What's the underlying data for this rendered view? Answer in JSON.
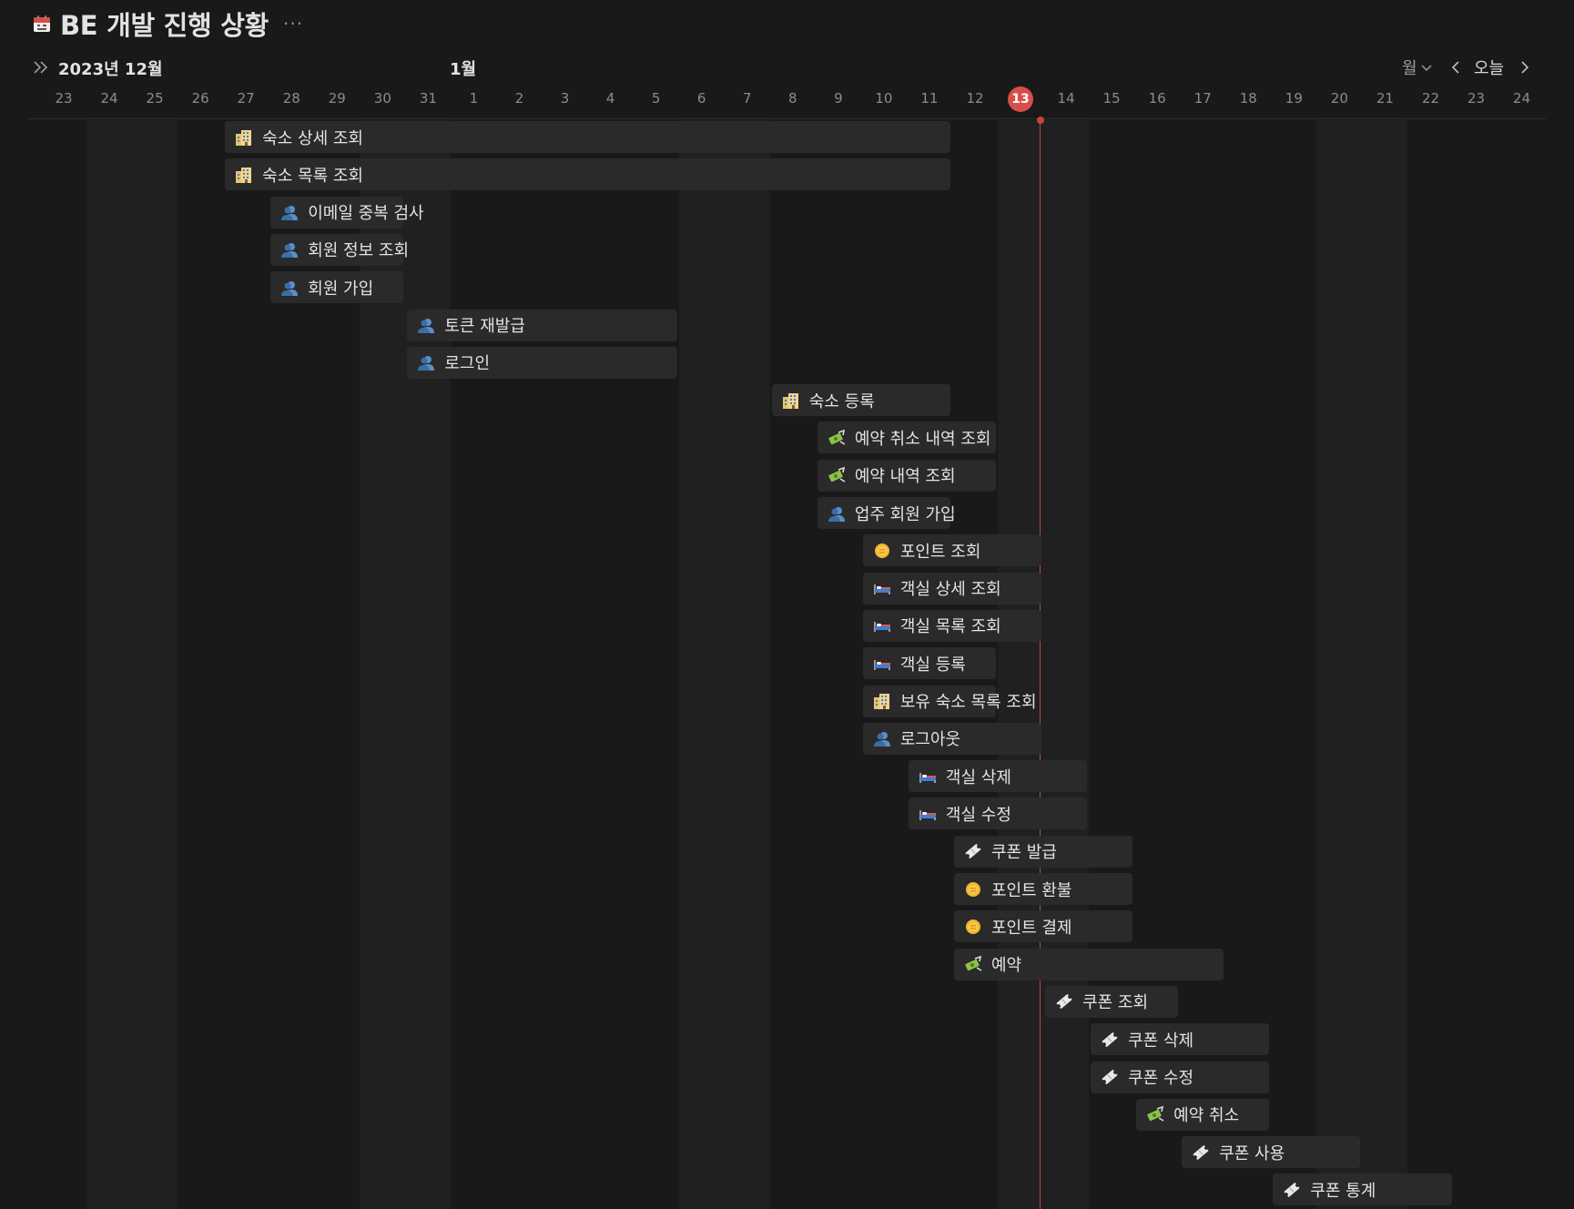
{
  "header": {
    "title": "BE 개발 진행 상황",
    "more": "···"
  },
  "nav": {
    "month": "2023년 12월",
    "next_month": "1월",
    "view": "월",
    "today": "오늘"
  },
  "timeline": {
    "days": [
      "23",
      "24",
      "25",
      "26",
      "27",
      "28",
      "29",
      "30",
      "31",
      "1",
      "2",
      "3",
      "4",
      "5",
      "6",
      "7",
      "8",
      "9",
      "10",
      "11",
      "12",
      "13",
      "14",
      "15",
      "16",
      "17",
      "18",
      "19",
      "20",
      "21",
      "22",
      "23",
      "24"
    ],
    "today_label": "13",
    "weekend_indices": [
      1,
      2,
      7,
      8,
      14,
      15,
      21,
      22,
      28,
      29
    ]
  },
  "tasks": [
    {
      "label": "숙소 상세 조회",
      "icon": "building",
      "start": 4,
      "end": 19
    },
    {
      "label": "숙소 목록 조회",
      "icon": "building",
      "start": 4,
      "end": 19
    },
    {
      "label": "이메일 중복 검사",
      "icon": "person",
      "start": 5,
      "end": 7
    },
    {
      "label": "회원 정보 조회",
      "icon": "person",
      "start": 5,
      "end": 7
    },
    {
      "label": "회원 가입",
      "icon": "person",
      "start": 5,
      "end": 7
    },
    {
      "label": "토큰 재발급",
      "icon": "person",
      "start": 8,
      "end": 13
    },
    {
      "label": "로그인",
      "icon": "person",
      "start": 8,
      "end": 13
    },
    {
      "label": "숙소 등록",
      "icon": "building",
      "start": 16,
      "end": 19
    },
    {
      "label": "예약 취소 내역 조회",
      "icon": "money",
      "start": 17,
      "end": 20
    },
    {
      "label": "예약 내역 조회",
      "icon": "money",
      "start": 17,
      "end": 20
    },
    {
      "label": "업주 회원 가입",
      "icon": "person",
      "start": 17,
      "end": 19
    },
    {
      "label": "포인트 조회",
      "icon": "coin",
      "start": 18,
      "end": 21
    },
    {
      "label": "객실 상세 조회",
      "icon": "bed",
      "start": 18,
      "end": 21
    },
    {
      "label": "객실 목록 조회",
      "icon": "bed",
      "start": 18,
      "end": 21
    },
    {
      "label": "객실 등록",
      "icon": "bed",
      "start": 18,
      "end": 20
    },
    {
      "label": "보유 숙소 목록 조회",
      "icon": "building",
      "start": 18,
      "end": 20
    },
    {
      "label": "로그아웃",
      "icon": "person",
      "start": 18,
      "end": 21
    },
    {
      "label": "객실 삭제",
      "icon": "bed",
      "start": 19,
      "end": 22
    },
    {
      "label": "객실 수정",
      "icon": "bed",
      "start": 19,
      "end": 22
    },
    {
      "label": "쿠폰 발급",
      "icon": "ticket",
      "start": 20,
      "end": 23
    },
    {
      "label": "포인트 환불",
      "icon": "coin",
      "start": 20,
      "end": 23
    },
    {
      "label": "포인트 결제",
      "icon": "coin",
      "start": 20,
      "end": 23
    },
    {
      "label": "예약",
      "icon": "money",
      "start": 20,
      "end": 25
    },
    {
      "label": "쿠폰 조회",
      "icon": "ticket",
      "start": 22,
      "end": 24
    },
    {
      "label": "쿠폰 삭제",
      "icon": "ticket",
      "start": 23,
      "end": 26
    },
    {
      "label": "쿠폰 수정",
      "icon": "ticket",
      "start": 23,
      "end": 26
    },
    {
      "label": "예약 취소",
      "icon": "money",
      "start": 24,
      "end": 26
    },
    {
      "label": "쿠폰 사용",
      "icon": "ticket",
      "start": 25,
      "end": 28
    },
    {
      "label": "쿠폰 통계",
      "icon": "ticket",
      "start": 27,
      "end": 30
    }
  ],
  "colors": {
    "background": "#191919",
    "weekend": "#202020",
    "bar": "#2a2a2a",
    "today": "#d74e4a",
    "now_line": "#c9433e"
  }
}
